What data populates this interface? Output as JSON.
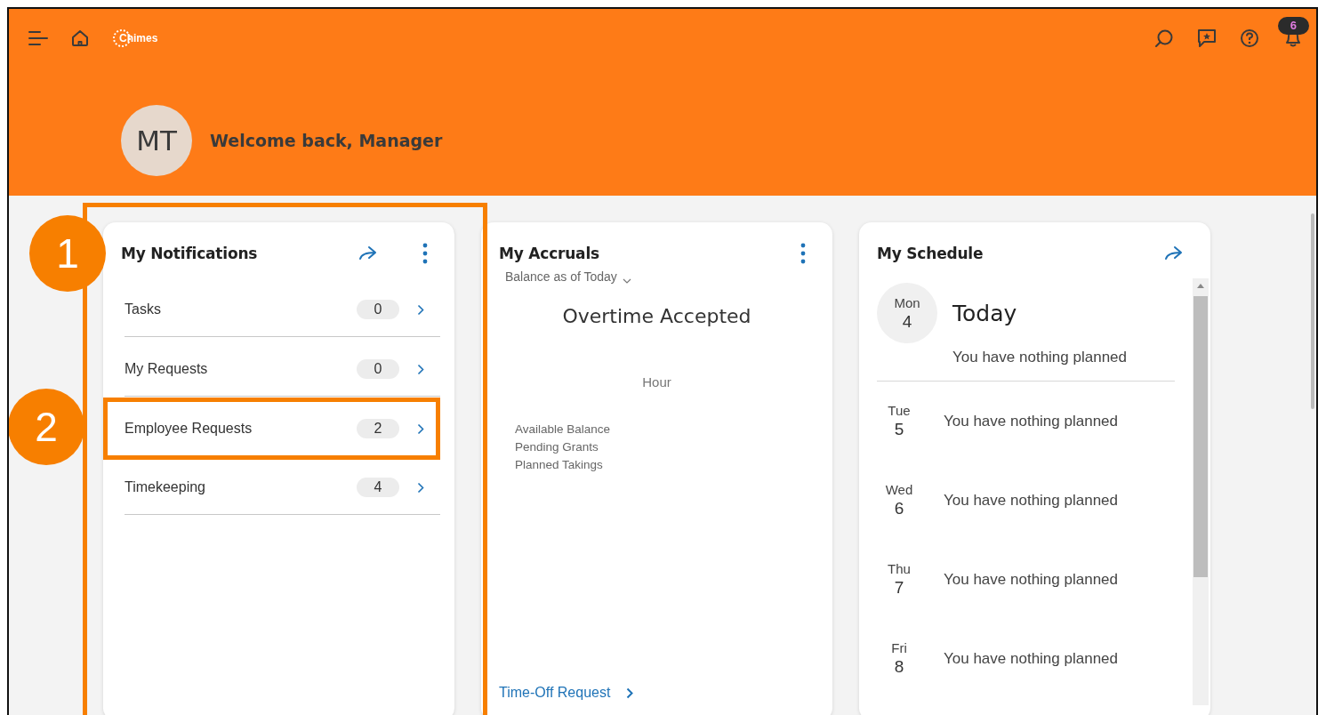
{
  "header": {
    "logo": "Chimes",
    "notification_count": "6",
    "avatar_initials": "MT",
    "welcome": "Welcome back, Manager"
  },
  "notifications": {
    "title": "My Notifications",
    "items": [
      {
        "label": "Tasks",
        "count": "0",
        "highlighted": false
      },
      {
        "label": "My Requests",
        "count": "0",
        "highlighted": false
      },
      {
        "label": "Employee Requests",
        "count": "2",
        "highlighted": true,
        "callout": "2"
      },
      {
        "label": "Timekeeping",
        "count": "4",
        "highlighted": false
      }
    ],
    "callout": "1"
  },
  "accruals": {
    "title": "My Accruals",
    "period": "Balance as of Today",
    "heading": "Overtime Accepted",
    "unit": "Hour",
    "legend": [
      "Available Balance",
      "Pending Grants",
      "Planned Takings"
    ],
    "link": "Time-Off Request"
  },
  "schedule": {
    "title": "My Schedule",
    "today": {
      "day": "Mon",
      "date": "4",
      "label": "Today",
      "note": "You have nothing planned"
    },
    "days": [
      {
        "day": "Tue",
        "date": "5",
        "note": "You have nothing planned"
      },
      {
        "day": "Wed",
        "date": "6",
        "note": "You have nothing planned"
      },
      {
        "day": "Thu",
        "date": "7",
        "note": "You have nothing planned"
      },
      {
        "day": "Fri",
        "date": "8",
        "note": "You have nothing planned"
      }
    ]
  }
}
